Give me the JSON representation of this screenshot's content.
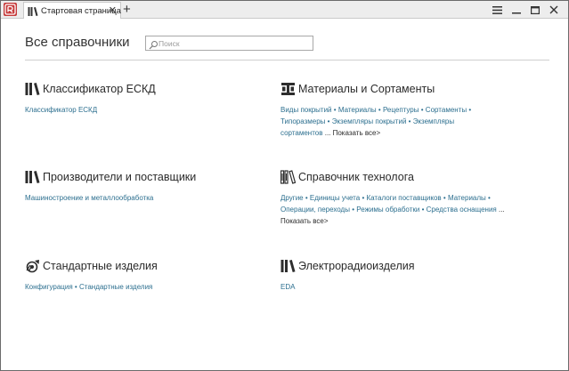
{
  "tab": {
    "label": "Стартовая страница",
    "close": "✕"
  },
  "new_tab": "+",
  "header": {
    "title": "Все справочники",
    "search_placeholder": "Поиск",
    "search_value": ""
  },
  "sections": [
    {
      "title": "Классификатор ЕСКД",
      "icon": "books-icon",
      "links": [
        "Классификатор ЕСКД"
      ]
    },
    {
      "title": "Материалы и Сортаменты",
      "icon": "materials-icon",
      "links": [
        "Виды покрытий",
        "Материалы",
        "Рецептуры",
        "Сортаменты",
        "Типоразмеры",
        "Экземпляры покрытий",
        "Экземпляры сортаментов"
      ],
      "show_all": "... Показать все>"
    },
    {
      "title": "Производители и поставщики",
      "icon": "books-icon",
      "links": [
        "Машиностроение и металлообработка"
      ]
    },
    {
      "title": "Справочник технолога",
      "icon": "technologist-books-icon",
      "links": [
        "Другие",
        "Единицы учета",
        "Каталоги поставщиков",
        "Материалы",
        "Операции, переходы",
        "Режимы обработки",
        "Средства оснащения"
      ],
      "show_all": "... Показать все>"
    },
    {
      "title": "Стандартные изделия",
      "icon": "standard-parts-icon",
      "links": [
        "Конфигурация",
        "Стандартные изделия"
      ]
    },
    {
      "title": "Электрорадиоизделия",
      "icon": "books-icon",
      "links": [
        "EDA"
      ]
    }
  ],
  "colors": {
    "link": "#2c6f8f",
    "text": "#2b2b2b",
    "app_icon": "#c63a3a"
  }
}
